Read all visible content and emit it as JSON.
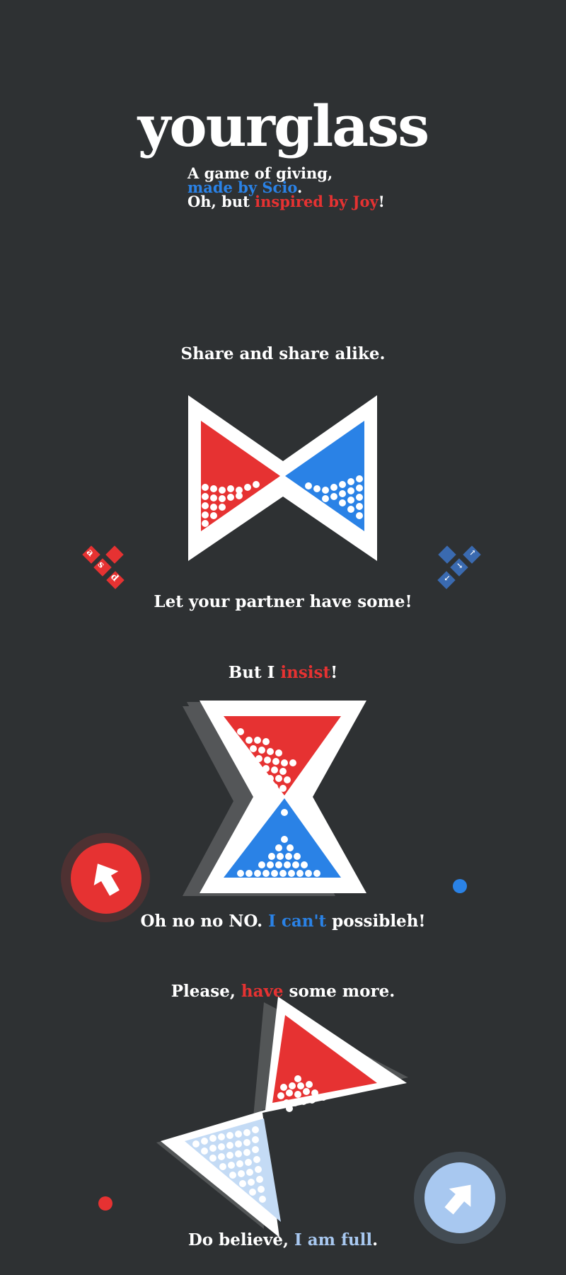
{
  "header": {
    "title": "yourglass",
    "line1": "A game of giving,",
    "line2_prefix": "made by ",
    "line2_author": "Scio",
    "line2_suffix": ".",
    "line3_prefix": "Oh, but ",
    "line3_highlight": "inspired by Joy",
    "line3_suffix": "!"
  },
  "sections": [
    {
      "top_text": "Share and share alike.",
      "bottom_text": "Let your partner have some!",
      "red_keys": [
        "a",
        "s",
        "d"
      ],
      "blue_keys": [
        "↑",
        "→",
        "↓"
      ]
    },
    {
      "top_prefix": "But I ",
      "top_highlight": "insist",
      "top_suffix": "!",
      "bottom_prefix": "Oh no no NO. ",
      "bottom_highlight": "I can't",
      "bottom_suffix": " possibleh!"
    },
    {
      "top_prefix": "Please, ",
      "top_highlight": "have",
      "top_suffix": " some more.",
      "bottom_prefix": "Do believe, ",
      "bottom_highlight": "I am full",
      "bottom_suffix": "."
    }
  ],
  "colors": {
    "background": "#2e3133",
    "player_red": "#e63232",
    "player_blue": "#2a82e6",
    "blue_light": "#a8c8f0",
    "frame": "#ffffff"
  },
  "icons": [
    "hourglass-icon",
    "arrow-up-left-icon",
    "arrow-up-right-icon",
    "dot-icon",
    "key-tile-icon"
  ]
}
